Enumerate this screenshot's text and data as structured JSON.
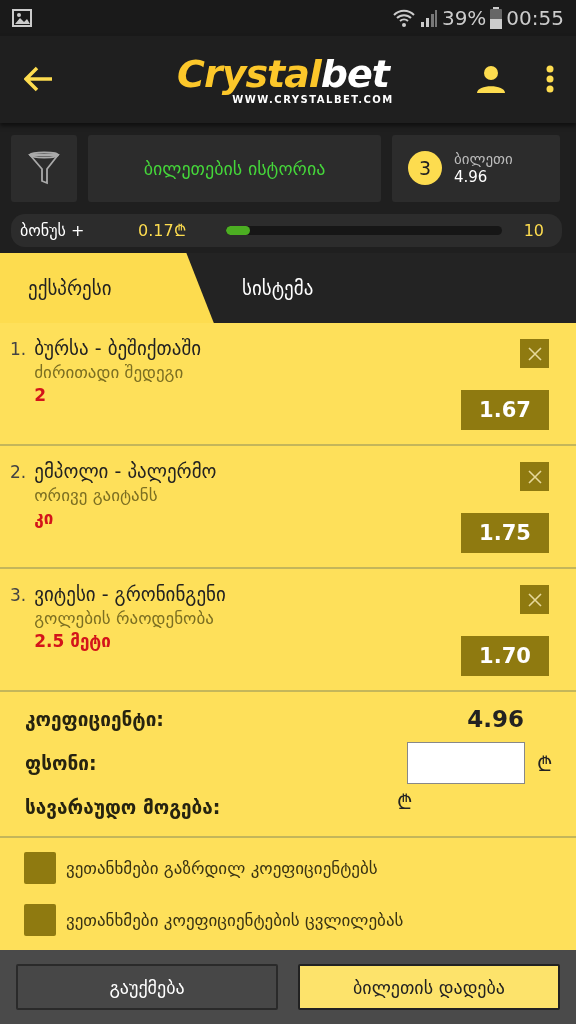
{
  "status_bar": {
    "battery": "39%",
    "time": "00:55"
  },
  "header": {
    "logo_main": "Crystal",
    "logo_accent": "bet",
    "logo_url": "WWW.CRYSTALBET.COM"
  },
  "ticket_bar": {
    "history_button": "ბილეთების ისტორია",
    "count": "3",
    "ticket_label": "ბილეთი",
    "ticket_odds": "4.96"
  },
  "bonus": {
    "label": "ბონუს +",
    "amount": "0.17₾",
    "level": 0.09,
    "target": "10"
  },
  "tabs": [
    {
      "label": "ექსპრესი",
      "selected": true
    },
    {
      "label": "სისტემა",
      "selected": false
    }
  ],
  "bets": [
    {
      "number": "1.",
      "match": "ბურსა - ბეშიქთაში",
      "market": "ძირითადი შედეგი",
      "pick": "2",
      "odds": "1.67"
    },
    {
      "number": "2.",
      "match": "ემპოლი - პალერმო",
      "market": "ორივე გაიტანს",
      "pick": "კი",
      "odds": "1.75"
    },
    {
      "number": "3.",
      "match": "ვიტესი - გრონინგენი",
      "market": "გოლების რაოდენობა",
      "pick": "2.5 მეტი",
      "odds": "1.70"
    }
  ],
  "summary": {
    "odds_label": "კოეფიციენტი:",
    "odds_value": "4.96",
    "stake_label": "ფსონი:",
    "stake_currency": "₾",
    "win_label": "სავარაუდო მოგება:",
    "win_currency": "₾"
  },
  "agreements": [
    {
      "label": "ვეთანხმები გაზრდილ კოეფიციენტებს",
      "checked": false
    },
    {
      "label": "ვეთანხმები კოეფიციენტების ცვლილებას",
      "checked": false
    }
  ],
  "buttons": [
    {
      "kind": "cancel",
      "label": "გაუქმება"
    },
    {
      "kind": "submit",
      "label": "ბილეთის დადება"
    }
  ]
}
